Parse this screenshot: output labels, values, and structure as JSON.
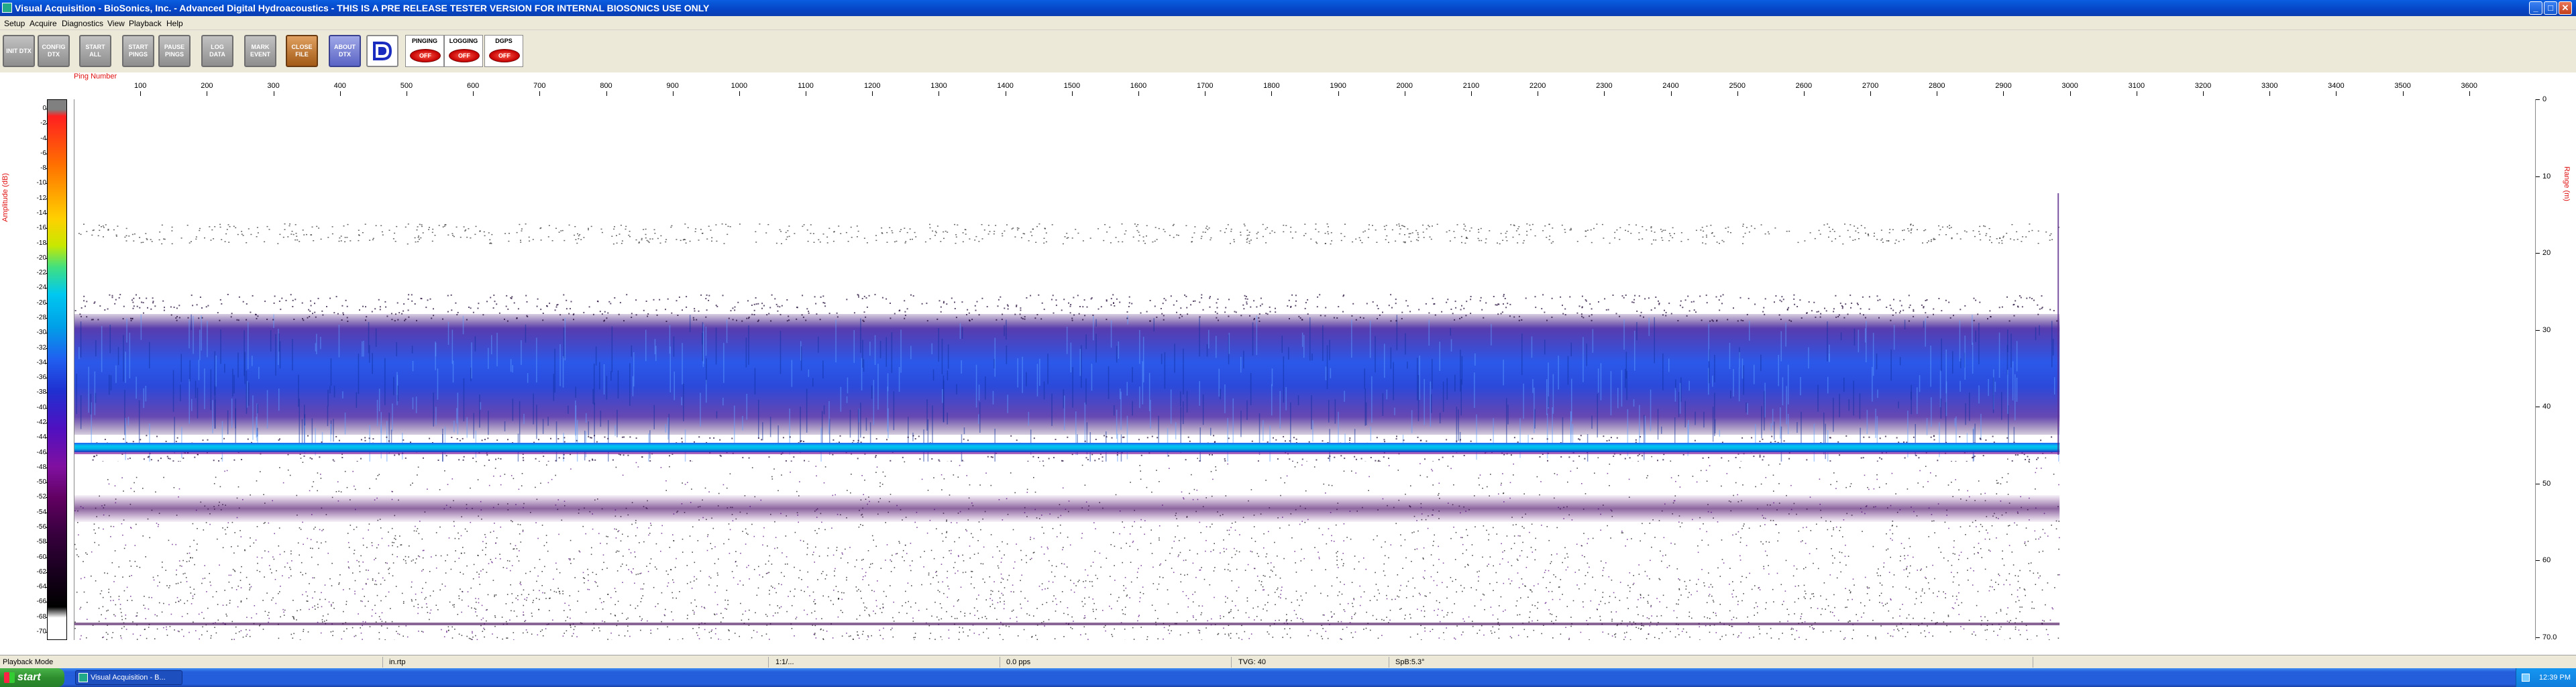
{
  "window": {
    "title": "Visual Acquisition  -  BioSonics, Inc.  -  Advanced Digital Hydroacoustics  -  THIS IS A PRE RELEASE TESTER VERSION FOR INTERNAL BIOSONICS USE ONLY",
    "minimize": "_",
    "maximize": "□",
    "close": "✕"
  },
  "menu": [
    "Setup",
    "Acquire",
    "Diagnostics",
    "View",
    "Playback",
    "Help"
  ],
  "toolbar": {
    "buttons": [
      "INIT DTX",
      "CONFIG DTX",
      "START ALL",
      "START PINGS",
      "PAUSE PINGS",
      "LOG DATA",
      "MARK EVENT",
      "CLOSE FILE",
      "ABOUT DTX"
    ],
    "status": [
      {
        "label": "PINGING",
        "state": "OFF"
      },
      {
        "label": "LOGGING",
        "state": "OFF"
      },
      {
        "label": "DGPS",
        "state": "OFF"
      }
    ]
  },
  "echogram": {
    "x_axis_label": "Ping Number",
    "left_axis_label": "Amplitude (dB)",
    "right_axis_label": "Range (m)",
    "x_ticks": [
      "100",
      "200",
      "300",
      "400",
      "500",
      "600",
      "700",
      "800",
      "900",
      "1000",
      "1100",
      "1200",
      "1300",
      "1400",
      "1500",
      "1600",
      "1700",
      "1800",
      "1900",
      "2000",
      "2100",
      "2200",
      "2300",
      "2400",
      "2500",
      "2600",
      "2700",
      "2800",
      "2900",
      "3000",
      "3100",
      "3200",
      "3300",
      "3400",
      "3500",
      "3600"
    ],
    "colorbar_ticks": [
      "0",
      "-2",
      "-4",
      "-6",
      "-8",
      "-10",
      "-12",
      "-14",
      "-16",
      "-18",
      "-20",
      "-22",
      "-24",
      "-26",
      "-28",
      "-30",
      "-32",
      "-34",
      "-36",
      "-38",
      "-40",
      "-42",
      "-44",
      "-46",
      "-48",
      "-50",
      "-52",
      "-54",
      "-56",
      "-58",
      "-60",
      "-62",
      "-64",
      "-66",
      "-68",
      "-70"
    ],
    "range_ticks": [
      "0",
      "10",
      "20",
      "30",
      "40",
      "50",
      "60",
      "70.0"
    ]
  },
  "statusbar": {
    "mode": "Playback Mode",
    "file": "in.rtp",
    "time": "1:1/...",
    "ping_rate": "0.0 pps",
    "tvg": "TVG: 40",
    "spb": "SpB:5.3°"
  },
  "taskbar": {
    "start": "start",
    "item": "Visual Acquisition  -  B...",
    "clock": "12:39 PM"
  },
  "colors": {
    "accent": "#245edb",
    "echo_band": "#2a3ad0",
    "bottom_line": "#00c8f0"
  }
}
